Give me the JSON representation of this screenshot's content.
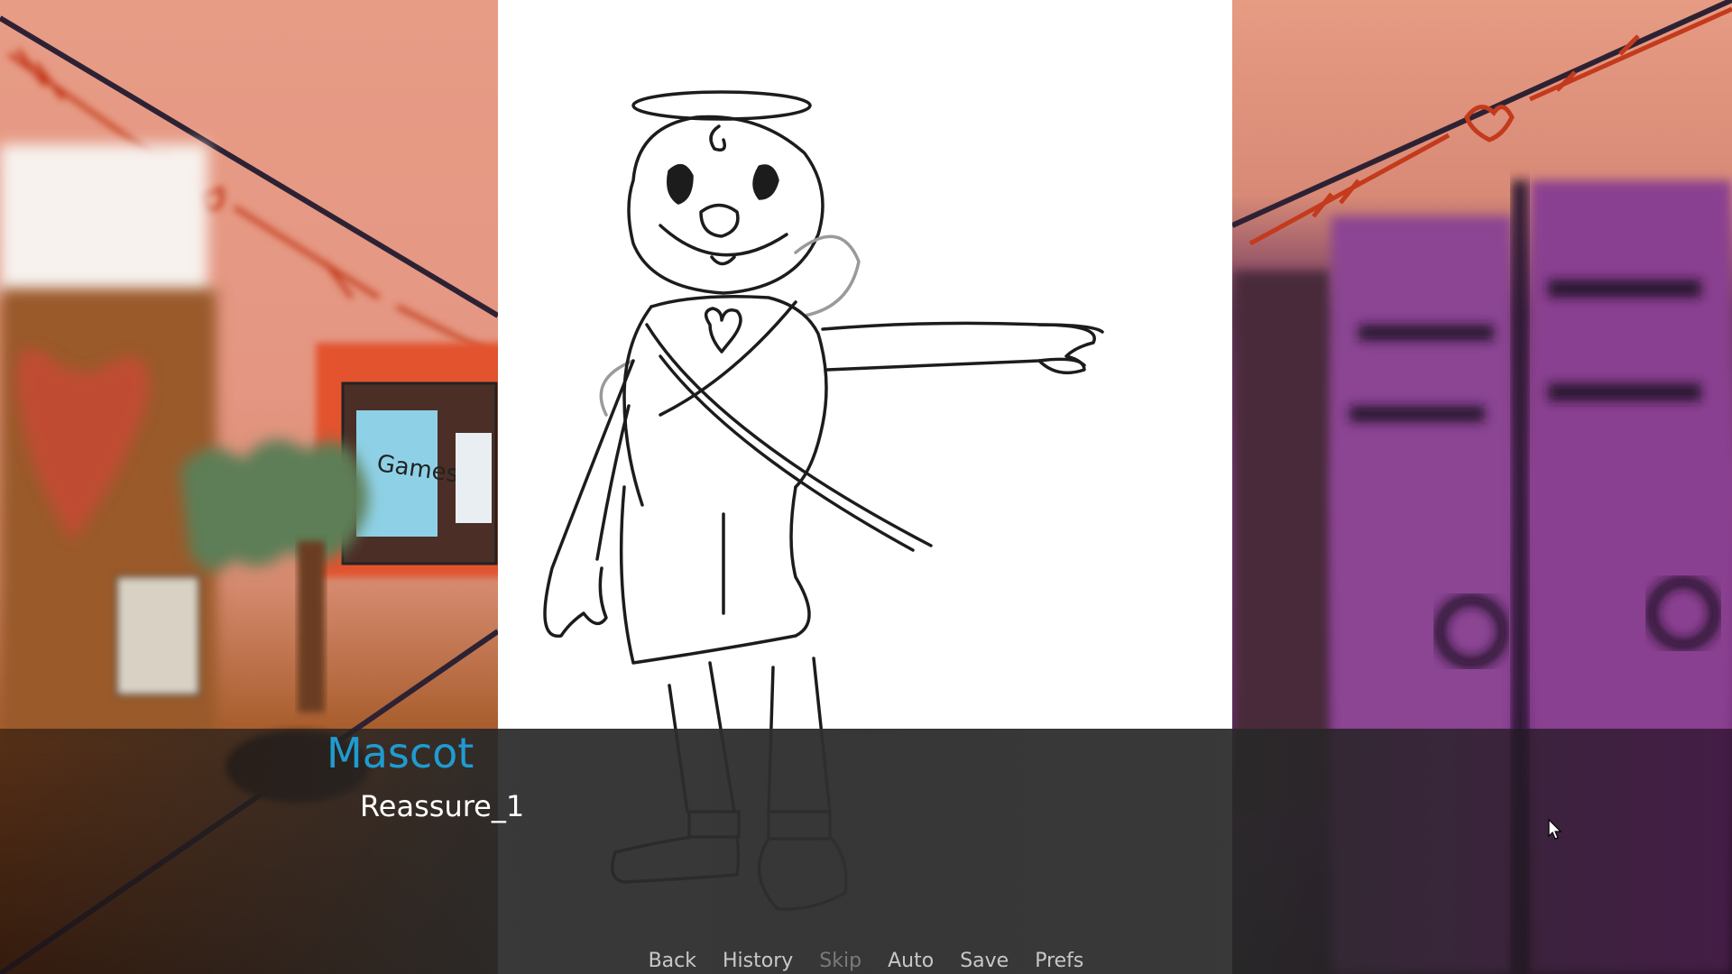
{
  "dialogue": {
    "speaker": "Mascot",
    "text": "Reassure_1"
  },
  "quick_menu": [
    {
      "label": "Back",
      "enabled": true
    },
    {
      "label": "History",
      "enabled": true
    },
    {
      "label": "Skip",
      "enabled": false
    },
    {
      "label": "Auto",
      "enabled": true
    },
    {
      "label": "Save",
      "enabled": true
    },
    {
      "label": "Prefs",
      "enabled": true
    }
  ],
  "background": {
    "left_signs": [
      "Games"
    ]
  },
  "colors": {
    "speaker_name": "#1f9bd1",
    "dialogue_text": "#ffffff",
    "menu_enabled": "#c8c8c8",
    "menu_disabled": "#7a7a7a"
  }
}
